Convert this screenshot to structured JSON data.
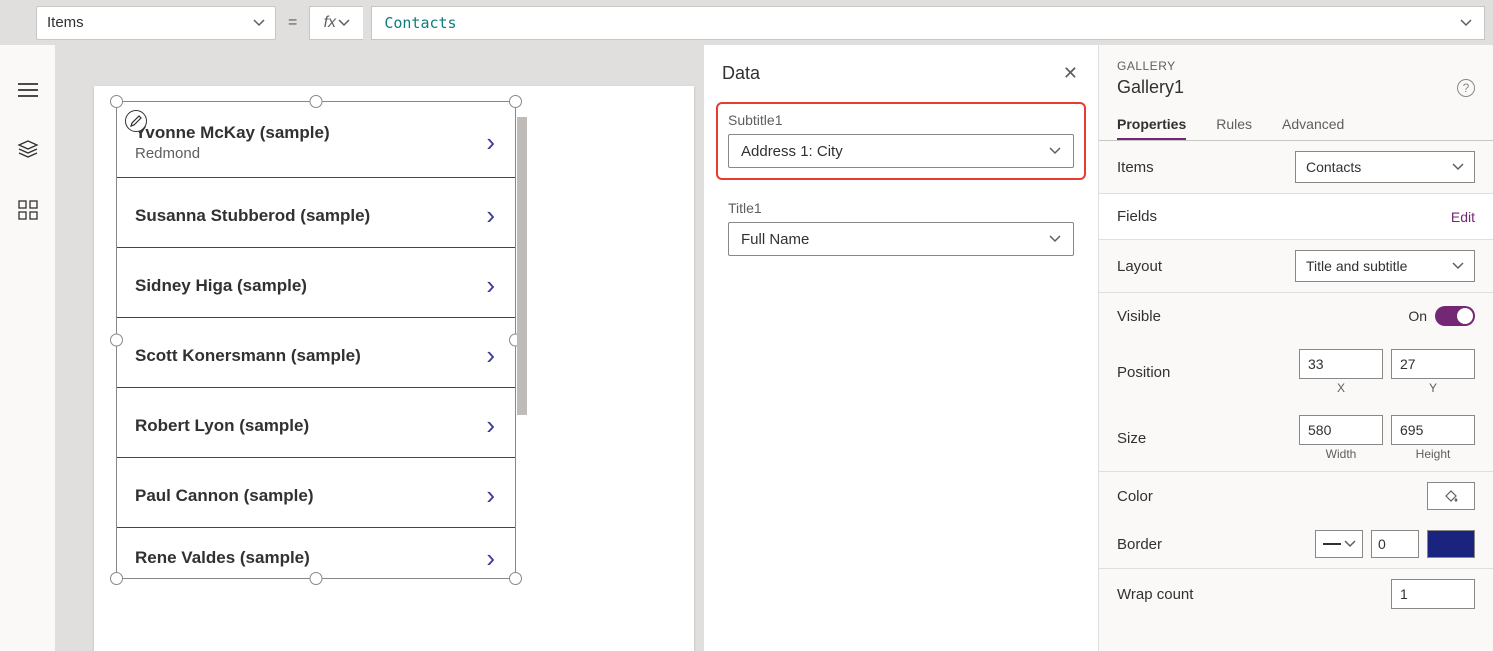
{
  "formula_bar": {
    "property": "Items",
    "equals": "=",
    "fx": "fx",
    "value": "Contacts"
  },
  "gallery": {
    "items": [
      {
        "title": "Yvonne McKay (sample)",
        "subtitle": "Redmond"
      },
      {
        "title": "Susanna Stubberod (sample)",
        "subtitle": ""
      },
      {
        "title": "Sidney Higa (sample)",
        "subtitle": ""
      },
      {
        "title": "Scott Konersmann (sample)",
        "subtitle": ""
      },
      {
        "title": "Robert Lyon (sample)",
        "subtitle": ""
      },
      {
        "title": "Paul Cannon (sample)",
        "subtitle": ""
      },
      {
        "title": "Rene Valdes (sample)",
        "subtitle": ""
      }
    ]
  },
  "data_pane": {
    "header": "Data",
    "fields": {
      "subtitle_label": "Subtitle1",
      "subtitle_value": "Address 1: City",
      "title_label": "Title1",
      "title_value": "Full Name"
    }
  },
  "props": {
    "crumb": "GALLERY",
    "name": "Gallery1",
    "tabs": {
      "properties": "Properties",
      "rules": "Rules",
      "advanced": "Advanced"
    },
    "items_label": "Items",
    "items_value": "Contacts",
    "fields_label": "Fields",
    "fields_edit": "Edit",
    "layout_label": "Layout",
    "layout_value": "Title and subtitle",
    "visible_label": "Visible",
    "visible_value": "On",
    "position_label": "Position",
    "position_x": "33",
    "position_y": "27",
    "position_xlabel": "X",
    "position_ylabel": "Y",
    "size_label": "Size",
    "size_w": "580",
    "size_h": "695",
    "size_wlabel": "Width",
    "size_hlabel": "Height",
    "color_label": "Color",
    "border_label": "Border",
    "border_width": "0",
    "wrap_label": "Wrap count",
    "wrap_value": "1"
  }
}
